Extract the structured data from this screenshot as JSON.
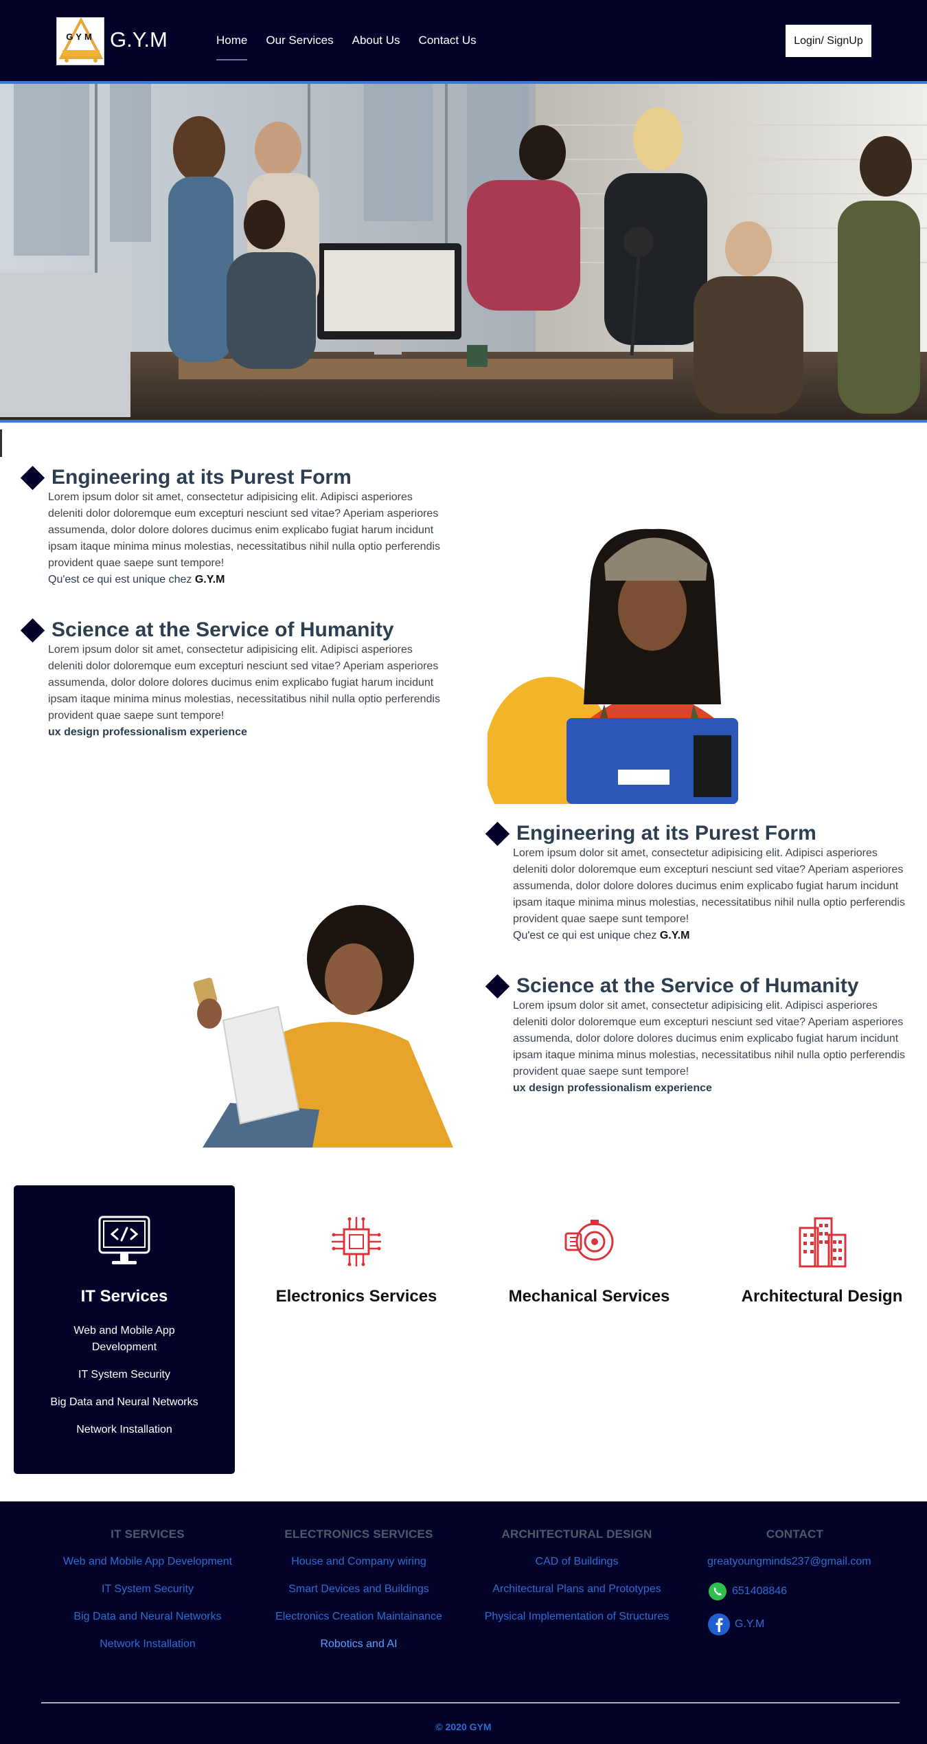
{
  "header": {
    "logo_letters": "GYM",
    "brand": "G.Y.M",
    "nav": [
      {
        "label": "Home",
        "active": true
      },
      {
        "label": "Our Services",
        "active": false
      },
      {
        "label": "About Us",
        "active": false
      },
      {
        "label": "Contact Us",
        "active": false
      }
    ],
    "login_label": "Login/ SignUp"
  },
  "features": [
    {
      "title": "Engineering at its Purest Form",
      "body": "Lorem ipsum dolor sit amet, consectetur adipisicing elit. Adipisci asperiores deleniti dolor doloremque eum excepturi nesciunt sed vitae? Aperiam asperiores assumenda, dolor dolore dolores ducimus enim explicabo fugiat harum incidunt ipsam itaque minima minus molestias, necessitatibus nihil nulla optio perferendis provident quae saepe sunt tempore!",
      "extra_prefix": "Qu'est ce qui est unique chez ",
      "extra_bold": "G.Y.M"
    },
    {
      "title": "Science at the Service of Humanity",
      "body": "Lorem ipsum dolor sit amet, consectetur adipisicing elit. Adipisci asperiores deleniti dolor doloremque eum excepturi nesciunt sed vitae? Aperiam asperiores assumenda, dolor dolore dolores ducimus enim explicabo fugiat harum incidunt ipsam itaque minima minus molestias, necessitatibus nihil nulla optio perferendis provident quae saepe sunt tempore!",
      "strong": "ux design professionalism experience"
    },
    {
      "title": "Engineering at its Purest Form",
      "body": "Lorem ipsum dolor sit amet, consectetur adipisicing elit. Adipisci asperiores deleniti dolor doloremque eum excepturi nesciunt sed vitae? Aperiam asperiores assumenda, dolor dolore dolores ducimus enim explicabo fugiat harum incidunt ipsam itaque minima minus molestias, necessitatibus nihil nulla optio perferendis provident quae saepe sunt tempore!",
      "extra_prefix": "Qu'est ce qui est unique chez ",
      "extra_bold": "G.Y.M"
    },
    {
      "title": "Science at the Service of Humanity",
      "body": "Lorem ipsum dolor sit amet, consectetur adipisicing elit. Adipisci asperiores deleniti dolor doloremque eum excepturi nesciunt sed vitae? Aperiam asperiores assumenda, dolor dolore dolores ducimus enim explicabo fugiat harum incidunt ipsam itaque minima minus molestias, necessitatibus nihil nulla optio perferendis provident quae saepe sunt tempore!",
      "strong": "ux design professionalism experience"
    }
  ],
  "services": [
    {
      "title": "IT Services",
      "icon": "monitor-code-icon",
      "items": [
        "Web and Mobile App Development",
        "IT System Security",
        "Big Data and Neural Networks",
        "Network Installation"
      ]
    },
    {
      "title": "Electronics Services",
      "icon": "circuit-chip-icon"
    },
    {
      "title": "Mechanical Services",
      "icon": "engine-icon"
    },
    {
      "title": "Architectural Design",
      "icon": "buildings-icon"
    }
  ],
  "footer": {
    "columns": [
      {
        "heading": "IT SERVICES",
        "links": [
          "Web and Mobile App Development",
          "IT System Security",
          "Big Data and Neural Networks",
          "Network Installation"
        ]
      },
      {
        "heading": "ELECTRONICS SERVICES",
        "links": [
          "House and Company wiring",
          "Smart Devices and Buildings",
          "Electronics Creation Maintainance",
          "Robotics and AI"
        ]
      },
      {
        "heading": "ARCHITECTURAL DESIGN",
        "links": [
          "CAD of Buildings",
          "Architectural Plans and Prototypes",
          "Physical Implementation of Structures"
        ]
      }
    ],
    "contact": {
      "heading": "CONTACT",
      "email": "greatyoungminds237@gmail.com",
      "phone": "651408846",
      "facebook": "G.Y.M"
    },
    "copyright": "© 2020 GYM"
  },
  "colors": {
    "navy": "#03032a",
    "accent_blue": "#3b7ad8",
    "icon_red": "#d9343c",
    "link_blue": "#2f6cd0"
  }
}
